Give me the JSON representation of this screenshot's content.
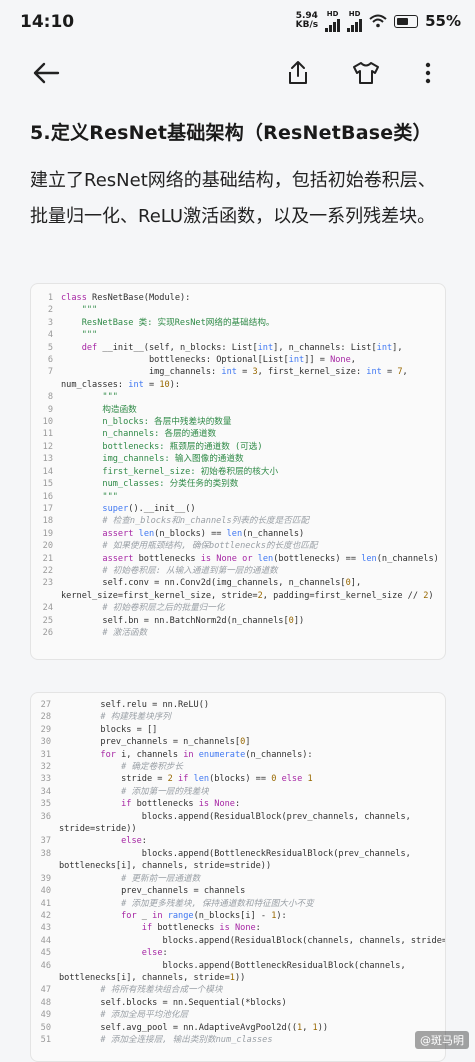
{
  "status_bar": {
    "time": "14:10",
    "speed_value": "5.94",
    "speed_unit": "KB/s",
    "network_1": "HD",
    "network_2": "HD",
    "battery": "55%"
  },
  "toolbar": {
    "back_icon": "arrow-left-icon",
    "share_icon": "share-icon",
    "shirt_icon": "tshirt-icon",
    "more_icon": "more-vertical-icon"
  },
  "article": {
    "heading": "5.定义ResNet基础架构（ResNetBase类）",
    "paragraph": "建立了ResNet网络的基础结构，包括初始卷积层、批量归一化、ReLU激活函数，以及一系列残差块。"
  },
  "code_card_1": {
    "lines": [
      {
        "n": "1",
        "t": "class ResNetBase(Module):"
      },
      {
        "n": "2",
        "t": "    \"\"\""
      },
      {
        "n": "3",
        "t": "    ResNetBase 类: 实现ResNet网络的基础结构。"
      },
      {
        "n": "4",
        "t": "    \"\"\""
      },
      {
        "n": "5",
        "t": "    def __init__(self, n_blocks: List[int], n_channels: List[int],"
      },
      {
        "n": "6",
        "t": "                 bottlenecks: Optional[List[int]] = None,"
      },
      {
        "n": "7",
        "t": "                 img_channels: int = 3, first_kernel_size: int = 7,"
      },
      {
        "n": "",
        "t": "num_classes: int = 10):"
      },
      {
        "n": "8",
        "t": "        \"\"\""
      },
      {
        "n": "9",
        "t": "        构造函数"
      },
      {
        "n": "10",
        "t": "        n_blocks: 各层中残差块的数量"
      },
      {
        "n": "11",
        "t": "        n_channels: 各层的通道数"
      },
      {
        "n": "12",
        "t": "        bottlenecks: 瓶颈层的通道数 (可选)"
      },
      {
        "n": "13",
        "t": "        img_channels: 输入图像的通道数"
      },
      {
        "n": "14",
        "t": "        first_kernel_size: 初始卷积层的核大小"
      },
      {
        "n": "15",
        "t": "        num_classes: 分类任务的类别数"
      },
      {
        "n": "16",
        "t": "        \"\"\""
      },
      {
        "n": "17",
        "t": "        super().__init__()"
      },
      {
        "n": "18",
        "t": "        # 检查n_blocks和n_channels列表的长度是否匹配"
      },
      {
        "n": "19",
        "t": "        assert len(n_blocks) == len(n_channels)"
      },
      {
        "n": "20",
        "t": "        # 如果使用瓶颈结构, 确保bottlenecks的长度也匹配"
      },
      {
        "n": "21",
        "t": "        assert bottlenecks is None or len(bottlenecks) == len(n_channels)"
      },
      {
        "n": "22",
        "t": "        # 初始卷积层: 从输入通道到第一层的通道数"
      },
      {
        "n": "23",
        "t": "        self.conv = nn.Conv2d(img_channels, n_channels[0],"
      },
      {
        "n": "",
        "t": "kernel_size=first_kernel_size, stride=2, padding=first_kernel_size // 2)"
      },
      {
        "n": "24",
        "t": "        # 初始卷积层之后的批量归一化"
      },
      {
        "n": "25",
        "t": "        self.bn = nn.BatchNorm2d(n_channels[0])"
      },
      {
        "n": "26",
        "t": "        # 激活函数"
      }
    ]
  },
  "code_card_2": {
    "lines": [
      {
        "n": "27",
        "t": "        self.relu = nn.ReLU()"
      },
      {
        "n": "28",
        "t": "        # 构建残差块序列"
      },
      {
        "n": "29",
        "t": "        blocks = []"
      },
      {
        "n": "30",
        "t": "        prev_channels = n_channels[0]"
      },
      {
        "n": "31",
        "t": "        for i, channels in enumerate(n_channels):"
      },
      {
        "n": "32",
        "t": "            # 确定卷积步长"
      },
      {
        "n": "33",
        "t": "            stride = 2 if len(blocks) == 0 else 1"
      },
      {
        "n": "34",
        "t": "            # 添加第一层的残差块"
      },
      {
        "n": "35",
        "t": "            if bottlenecks is None:"
      },
      {
        "n": "36",
        "t": "                blocks.append(ResidualBlock(prev_channels, channels,"
      },
      {
        "n": "",
        "t": "stride=stride))"
      },
      {
        "n": "37",
        "t": "            else:"
      },
      {
        "n": "38",
        "t": "                blocks.append(BottleneckResidualBlock(prev_channels,"
      },
      {
        "n": "",
        "t": "bottlenecks[i], channels, stride=stride))"
      },
      {
        "n": "39",
        "t": "            # 更新前一层通道数"
      },
      {
        "n": "40",
        "t": "            prev_channels = channels"
      },
      {
        "n": "41",
        "t": "            # 添加更多残差块, 保持通道数和特征图大小不变"
      },
      {
        "n": "42",
        "t": "            for _ in range(n_blocks[i] - 1):"
      },
      {
        "n": "43",
        "t": "                if bottlenecks is None:"
      },
      {
        "n": "44",
        "t": "                    blocks.append(ResidualBlock(channels, channels, stride=1))"
      },
      {
        "n": "45",
        "t": "                else:"
      },
      {
        "n": "46",
        "t": "                    blocks.append(BottleneckResidualBlock(channels,"
      },
      {
        "n": "",
        "t": "bottlenecks[i], channels, stride=1))"
      },
      {
        "n": "47",
        "t": "        # 将所有残差块组合成一个模块"
      },
      {
        "n": "48",
        "t": "        self.blocks = nn.Sequential(*blocks)"
      },
      {
        "n": "49",
        "t": "        # 添加全局平均池化层"
      },
      {
        "n": "50",
        "t": "        self.avg_pool = nn.AdaptiveAvgPool2d((1, 1))"
      },
      {
        "n": "51",
        "t": "        # 添加全连接层, 输出类别数num_classes"
      }
    ]
  },
  "watermark": "@斑马明"
}
